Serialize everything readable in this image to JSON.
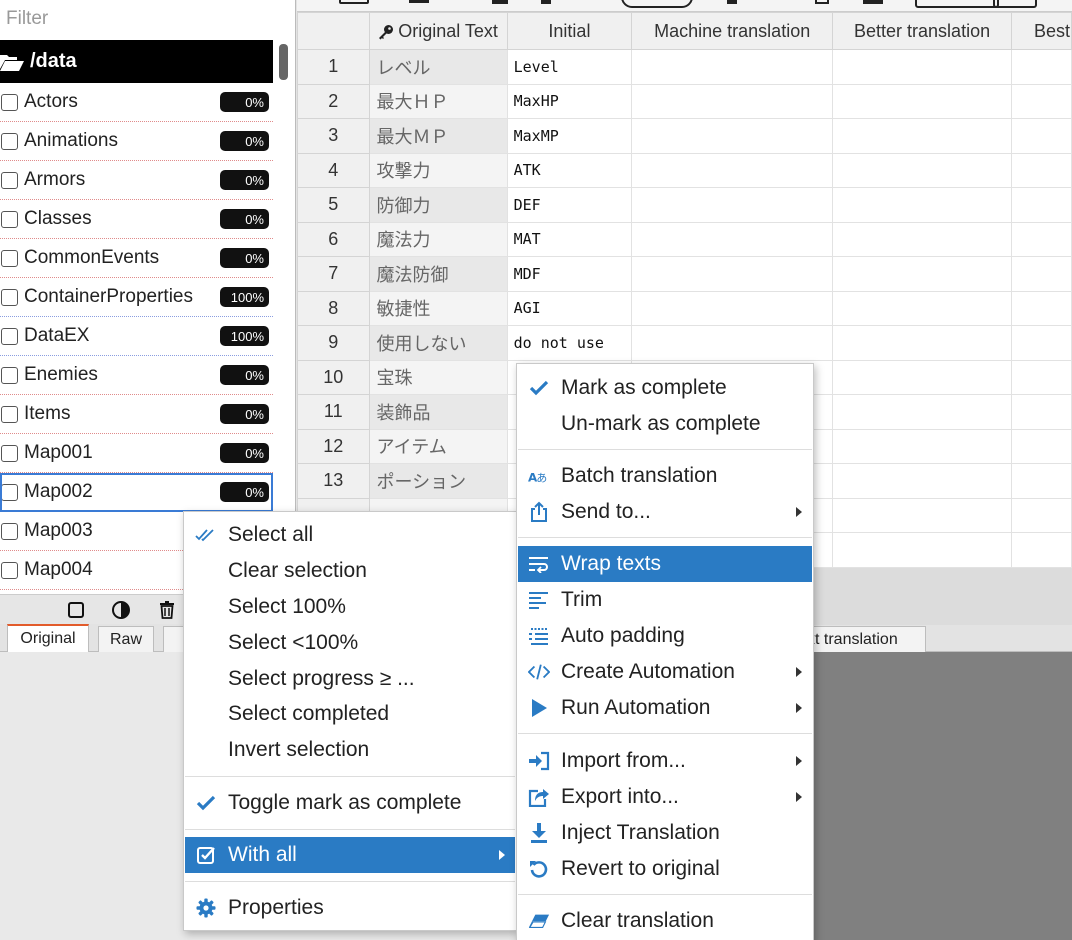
{
  "sidebar": {
    "filter_placeholder": "Filter",
    "folder": "/data",
    "files": [
      {
        "name": "Actors",
        "progress": "0%"
      },
      {
        "name": "Animations",
        "progress": "0%"
      },
      {
        "name": "Armors",
        "progress": "0%"
      },
      {
        "name": "Classes",
        "progress": "0%"
      },
      {
        "name": "CommonEvents",
        "progress": "0%"
      },
      {
        "name": "ContainerProperties",
        "progress": "100%"
      },
      {
        "name": "DataEX",
        "progress": "100%"
      },
      {
        "name": "Enemies",
        "progress": "0%"
      },
      {
        "name": "Items",
        "progress": "0%"
      },
      {
        "name": "Map001",
        "progress": "0%"
      },
      {
        "name": "Map002",
        "progress": "0%"
      },
      {
        "name": "Map003",
        "progress": ""
      },
      {
        "name": "Map004",
        "progress": ""
      }
    ]
  },
  "bottom_tabs": {
    "original": "Original",
    "raw": "Raw",
    "context_translation": "xt translation"
  },
  "grid": {
    "headers": {
      "original": "Original Text",
      "initial": "Initial",
      "machine": "Machine translation",
      "better": "Better translation",
      "best": "Best"
    },
    "rows": [
      {
        "n": "1",
        "orig": "レベル",
        "init": "Level"
      },
      {
        "n": "2",
        "orig": "最大ＨＰ",
        "init": "MaxHP"
      },
      {
        "n": "3",
        "orig": "最大ＭＰ",
        "init": "MaxMP"
      },
      {
        "n": "4",
        "orig": "攻撃力",
        "init": "ATK"
      },
      {
        "n": "5",
        "orig": "防御力",
        "init": "DEF"
      },
      {
        "n": "6",
        "orig": "魔法力",
        "init": "MAT"
      },
      {
        "n": "7",
        "orig": "魔法防御",
        "init": "MDF"
      },
      {
        "n": "8",
        "orig": "敏捷性",
        "init": "AGI"
      },
      {
        "n": "9",
        "orig": "使用しない",
        "init": "do not use"
      },
      {
        "n": "10",
        "orig": "宝珠",
        "init": ""
      },
      {
        "n": "11",
        "orig": "装飾品",
        "init": ""
      },
      {
        "n": "12",
        "orig": "アイテム",
        "init": ""
      },
      {
        "n": "13",
        "orig": "ポーション",
        "init": ""
      },
      {
        "n": "",
        "orig": "",
        "init": ""
      },
      {
        "n": "",
        "orig": "",
        "init": ""
      }
    ]
  },
  "left_menu": {
    "select_all": "Select all",
    "clear_selection": "Clear selection",
    "select_100": "Select 100%",
    "select_lt_100": "Select <100%",
    "select_progress": "Select progress ≥ ...",
    "select_completed": "Select completed",
    "invert_selection": "Invert selection",
    "toggle_mark": "Toggle mark as complete",
    "with_all": "With all",
    "properties": "Properties"
  },
  "right_menu": {
    "mark_complete": "Mark as complete",
    "unmark_complete": "Un-mark as complete",
    "batch_translation": "Batch translation",
    "send_to": "Send to...",
    "wrap_texts": "Wrap texts",
    "trim": "Trim",
    "auto_padding": "Auto padding",
    "create_automation": "Create Automation",
    "run_automation": "Run Automation",
    "import_from": "Import from...",
    "export_into": "Export into...",
    "inject_translation": "Inject Translation",
    "revert_original": "Revert to original",
    "clear_translation": "Clear translation"
  },
  "colors": {
    "highlight": "#2a7bc4",
    "icon_blue": "#2a7bc4",
    "badge": "#111111"
  }
}
